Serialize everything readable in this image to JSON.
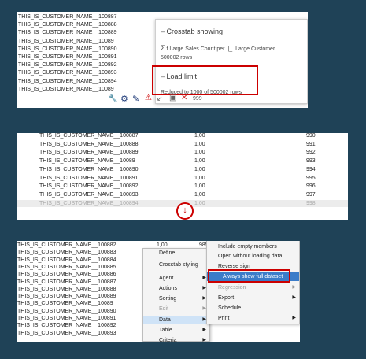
{
  "panel1": {
    "rows": [
      "THIS_IS_CUSTOMER_NAME__100887",
      "THIS_IS_CUSTOMER_NAME__100888",
      "THIS_IS_CUSTOMER_NAME__100889",
      "THIS_IS_CUSTOMER_NAME__10089",
      "THIS_IS_CUSTOMER_NAME__100890",
      "THIS_IS_CUSTOMER_NAME__100891",
      "THIS_IS_CUSTOMER_NAME__100892",
      "THIS_IS_CUSTOMER_NAME__100893",
      "THIS_IS_CUSTOMER_NAME__100894",
      "THIS_IS_CUSTOMER_NAME__10089"
    ],
    "overlay": {
      "section1_title": "Crosstab showing",
      "measure_text": "f Large Sales Count per",
      "dimension_text": "Large Customer",
      "rows_text": "500002 rows",
      "section2_title": "Load limit",
      "load_text": "Reduced to 1000 of 500002 rows"
    },
    "toolbar": {
      "value": "999"
    }
  },
  "panel2": {
    "rows": [
      {
        "name": "THIS_IS_CUSTOMER_NAME__100887",
        "value": "1,00",
        "rank": "990"
      },
      {
        "name": "THIS_IS_CUSTOMER_NAME__100888",
        "value": "1,00",
        "rank": "991"
      },
      {
        "name": "THIS_IS_CUSTOMER_NAME__100889",
        "value": "1,00",
        "rank": "992"
      },
      {
        "name": "THIS_IS_CUSTOMER_NAME__10089",
        "value": "1,00",
        "rank": "993"
      },
      {
        "name": "THIS_IS_CUSTOMER_NAME__100890",
        "value": "1,00",
        "rank": "994"
      },
      {
        "name": "THIS_IS_CUSTOMER_NAME__100891",
        "value": "1,00",
        "rank": "995"
      },
      {
        "name": "THIS_IS_CUSTOMER_NAME__100892",
        "value": "1,00",
        "rank": "996"
      },
      {
        "name": "THIS_IS_CUSTOMER_NAME__100893",
        "value": "1,00",
        "rank": "997"
      },
      {
        "name": "THIS_IS_CUSTOMER_NAME__100894",
        "value": "1,00",
        "rank": "998"
      }
    ],
    "load_more_symbol": "↓"
  },
  "panel3": {
    "rows": [
      "THIS_IS_CUSTOMER_NAME__100882",
      "THIS_IS_CUSTOMER_NAME__100883",
      "THIS_IS_CUSTOMER_NAME__100884",
      "THIS_IS_CUSTOMER_NAME__100885",
      "THIS_IS_CUSTOMER_NAME__100886",
      "THIS_IS_CUSTOMER_NAME__100887",
      "THIS_IS_CUSTOMER_NAME__100888",
      "THIS_IS_CUSTOMER_NAME__100889",
      "THIS_IS_CUSTOMER_NAME__10089",
      "THIS_IS_CUSTOMER_NAME__100890",
      "THIS_IS_CUSTOMER_NAME__100891",
      "THIS_IS_CUSTOMER_NAME__100892",
      "THIS_IS_CUSTOMER_NAME__100893"
    ],
    "first_value": "1,00",
    "first_rank": "985",
    "context_menu": [
      {
        "label": "Define",
        "arrow": false
      },
      {
        "label": "Crosstab styling",
        "arrow": false
      },
      {
        "label": "Agent",
        "arrow": true
      },
      {
        "label": "Actions",
        "arrow": true
      },
      {
        "label": "Sorting",
        "arrow": true
      },
      {
        "label": "Edit",
        "arrow": true,
        "disabled": true
      },
      {
        "label": "Data",
        "arrow": true,
        "highlighted": true
      },
      {
        "label": "Table",
        "arrow": true
      },
      {
        "label": "Criteria",
        "arrow": true
      }
    ],
    "sub_menu": [
      {
        "label": "Include empty members"
      },
      {
        "label": "Open without loading data"
      },
      {
        "label": "Reverse sign"
      },
      {
        "label": "Always show full dataset",
        "highlighted": true
      },
      {
        "label": "Regression",
        "arrow": true,
        "disabled": true
      },
      {
        "label": "Export",
        "arrow": true
      },
      {
        "label": "Schedule"
      },
      {
        "label": "Print",
        "arrow": true
      }
    ]
  },
  "colors": {
    "background": "#1f4257",
    "highlight_red": "#cc0000",
    "menu_highlight": "#3b7cc9"
  }
}
